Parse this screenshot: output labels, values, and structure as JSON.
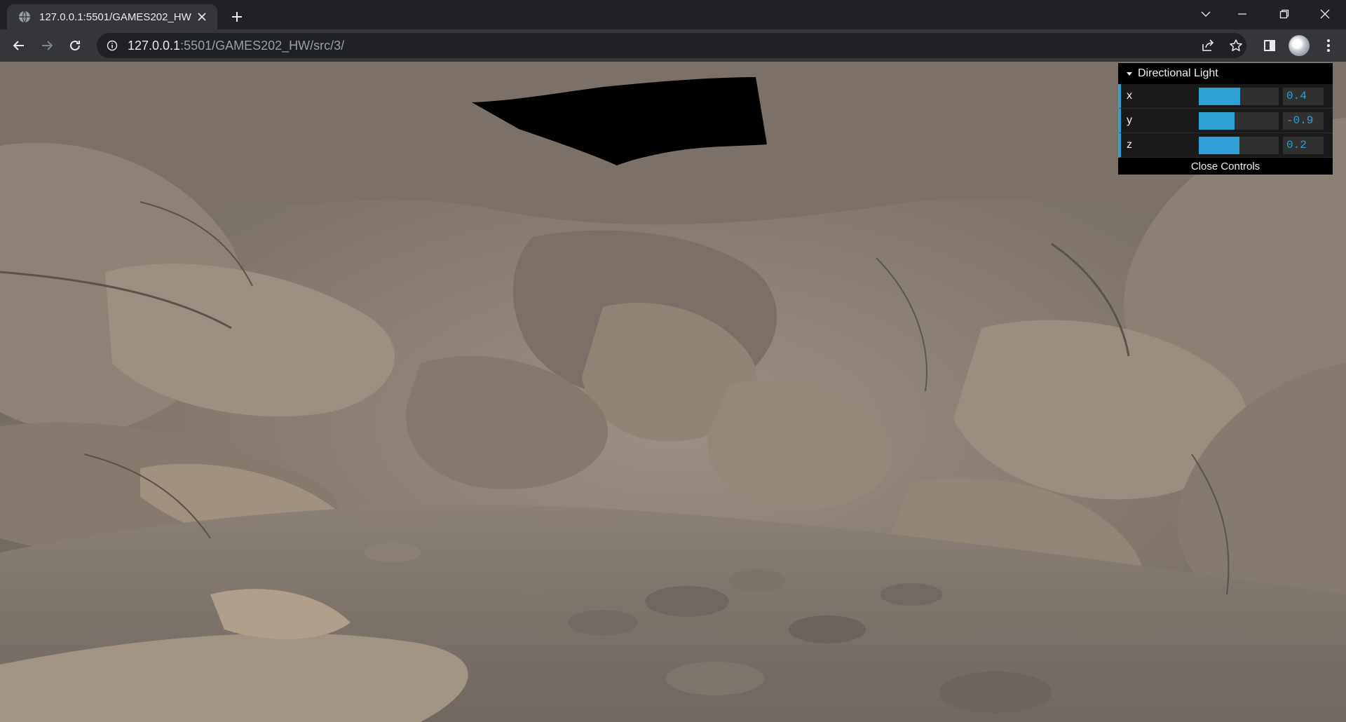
{
  "tab": {
    "title": "127.0.0.1:5501/GAMES202_HW",
    "favicon": "globe-icon"
  },
  "address_bar": {
    "host": "127.0.0.1",
    "path": ":5501/GAMES202_HW/src/3/"
  },
  "icons": {
    "back": "arrow-left-icon",
    "forward": "arrow-right-icon",
    "reload": "reload-icon",
    "site_info": "info-icon",
    "share": "share-icon",
    "bookmark": "star-icon",
    "side_panel": "side-panel-icon",
    "menu": "kebab-menu-icon"
  },
  "gui": {
    "folder_title": "Directional Light",
    "close_label": "Close Controls",
    "controls": [
      {
        "label": "x",
        "value": "0.4",
        "fill": 0.52
      },
      {
        "label": "y",
        "value": "-0.9",
        "fill": 0.45
      },
      {
        "label": "z",
        "value": "0.2",
        "fill": 0.51
      }
    ],
    "accent_color": "#2fa1d6"
  },
  "scene": {
    "description_label": "",
    "sky_color": "#000000",
    "rock_color": "#8a7f74"
  }
}
